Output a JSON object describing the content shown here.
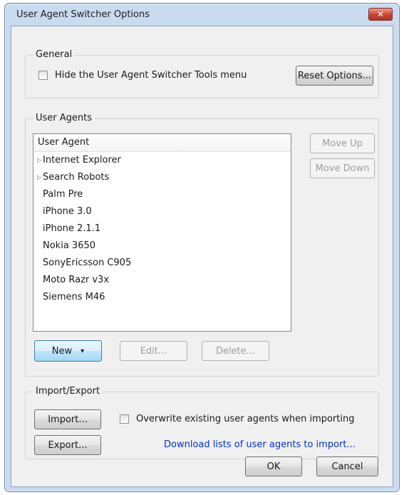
{
  "window": {
    "title": "User Agent Switcher Options",
    "close_glyph": "✕"
  },
  "general": {
    "label": "General",
    "hide_menu_label": "Hide the User Agent Switcher Tools menu",
    "reset_button": "Reset Options..."
  },
  "user_agents": {
    "label": "User Agents",
    "column_header": "User Agent",
    "items": [
      {
        "label": "Internet Explorer",
        "folder": true
      },
      {
        "label": "Search Robots",
        "folder": true
      },
      {
        "label": "Palm Pre",
        "folder": false
      },
      {
        "label": "iPhone 3.0",
        "folder": false
      },
      {
        "label": "iPhone 2.1.1",
        "folder": false
      },
      {
        "label": "Nokia 3650",
        "folder": false
      },
      {
        "label": "SonyEricsson C905",
        "folder": false
      },
      {
        "label": "Moto Razr v3x",
        "folder": false
      },
      {
        "label": "Siemens M46",
        "folder": false
      }
    ],
    "move_up": "Move Up",
    "move_down": "Move Down",
    "new_button": "New",
    "new_dropdown_glyph": "▾",
    "edit_button": "Edit...",
    "delete_button": "Delete..."
  },
  "import_export": {
    "label": "Import/Export",
    "import_button": "Import...",
    "export_button": "Export...",
    "overwrite_label": "Overwrite existing user agents when importing",
    "download_link": "Download lists of user agents to import..."
  },
  "footer": {
    "ok": "OK",
    "cancel": "Cancel"
  }
}
